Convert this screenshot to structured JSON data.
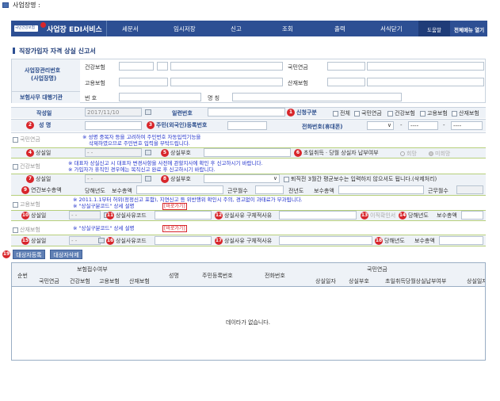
{
  "window": {
    "title": "사업장명 :"
  },
  "nav": {
    "brand": "국민건강보험",
    "title": "사업장 EDI서비스",
    "items": [
      "세문서",
      "임시저장",
      "신고",
      "조회",
      "출력",
      "서식닫기"
    ],
    "help": "도움말",
    "all_menu": "전체메뉴 열기"
  },
  "page_title": "직장가입자 자격 상실 신고서",
  "header_form": {
    "label_biz_no": "사업장관리번호\n(사업장명)",
    "label_health": "건강보험",
    "label_employ": "고용보험",
    "label_pension": "국민연금",
    "label_accident": "산재보험",
    "label_agent": "보험사무 대행기관",
    "label_no": "번 호",
    "label_name": "명 칭"
  },
  "section_date": {
    "label_written": "작성일",
    "written_value": "2017/11/10",
    "label_serial": "일련번호",
    "label_report_type": "신청구분",
    "report_types": [
      "전체",
      "국민연금",
      "건강보험",
      "고용보험",
      "산재보험"
    ]
  },
  "row_person": {
    "n2": "2",
    "label_name": "성 명",
    "n3": "3",
    "label_id": "주민(외국인)등록번호",
    "label_phone": "전화번호(휴대폰)"
  },
  "pension": {
    "head": "국민연금",
    "note1": "※ 성명 중복자 등을 고려하여 주민번호 자동입력기능을",
    "note2": "삭제하였으므로 주민번호 입력을 부탁드립니다.",
    "n4": "4",
    "label_loss_date": "상실일",
    "n5": "5",
    "label_loss_code": "상실부호",
    "n6": "6",
    "label_first": "초일취득ㆍ당월 상실자 납부여부",
    "opt_yes": "희망",
    "opt_no": "미희망"
  },
  "health": {
    "head": "건강보험",
    "note1": "※ 대표자 상실신고 시 대표자 변경사항을 사전에 관할지사에 확인 후 신고하시기 바랍니다.",
    "note2": "※ 가입자가 휴직인 경우에는 복직신고 완료 후 신고하시기 바랍니다.",
    "n7": "7",
    "label_loss_date": "상실일",
    "n8": "8",
    "label_loss_code": "상실부호",
    "note3": "퇴직전 3월간 평균보수는 입력하지 않으셔도 됩니다.(삭제처리)",
    "n9": "9",
    "label_annual": "연간보수총액",
    "label_year": "당해년도",
    "label_total": "보수총액",
    "label_months": "근무월수",
    "label_prev_year": "전년도",
    "label_total2": "보수총액",
    "label_months2": "근무월수"
  },
  "employ": {
    "head": "고용보험",
    "note1": "※ 2011.1.1부터 허위(정정신고 포함), 지연신고 등 위반행위 확인시 주의, 경고없이 과태료가 부과됩니다.",
    "note2": "※ \"상실구분코드\" 상세 설명",
    "shortcut": "[바로가기]",
    "n10": "10",
    "label_loss_date": "상실일",
    "n11": "11",
    "label_reason_code": "상실사유코드",
    "n12": "12",
    "label_reason_detail": "상실사유 구체적사유",
    "n13": "13",
    "label_confirm": "이직확인서",
    "n14": "14",
    "label_year": "당해년도",
    "label_total": "보수총액"
  },
  "accident": {
    "head": "산재보험",
    "note1": "※ \"상실구분코드\" 상세 설명",
    "shortcut": "[바로가기]",
    "n15": "15",
    "label_loss_date": "상실일",
    "n16": "16",
    "label_reason_code": "상실사유코드",
    "n17": "17",
    "label_reason_detail": "상실사유 구체적사유",
    "n18": "18",
    "label_year": "당해년도",
    "label_total": "보수총액"
  },
  "actions": {
    "n19": "19",
    "register": "대상자등록",
    "delete": "대상자삭제"
  },
  "table": {
    "col_seq": "순번",
    "col_receipt_group": "보험접수여부",
    "sub_receipt": [
      "국민연금",
      "건강보험",
      "고용보험",
      "산재보험"
    ],
    "col_name": "성명",
    "col_id": "주민등록번호",
    "col_phone": "전화번호",
    "col_pension_group": "국민연금",
    "sub_pension": [
      "상실일자",
      "상실부호",
      "초일취득당월상실납부여부",
      "상실일자"
    ],
    "empty": "데이타가 없습니다."
  },
  "date_placeholder": "- -",
  "phone_dash": "-",
  "phone_placeholder": "----",
  "colors": {
    "nav_bg": "#2d4f93",
    "accent_red": "#d8262b",
    "note_blue": "#2233cc"
  },
  "icons": {
    "window": "window-icon",
    "calendar": "calendar-icon",
    "brand": "brand-logo-icon"
  }
}
